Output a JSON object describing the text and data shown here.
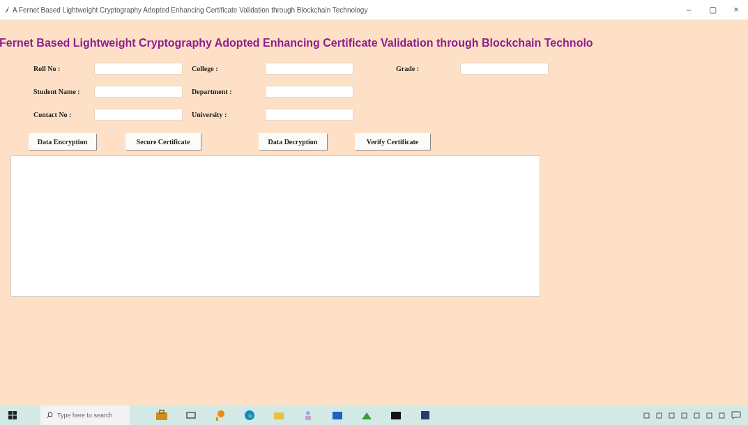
{
  "window": {
    "title": "A Fernet Based Lightweight Cryptography Adopted Enhancing Certificate Validation through Blockchain Technology",
    "controls": [
      "–",
      "▢",
      "×"
    ]
  },
  "heading": "Fernet Based Lightweight Cryptography Adopted Enhancing Certificate Validation through Blockchain Technolo",
  "form": {
    "rows": [
      [
        {
          "label": "Roll No :"
        },
        {
          "label": "College :"
        },
        {
          "label": "Grade :"
        }
      ],
      [
        {
          "label": "Student Name :"
        },
        {
          "label": "Department :"
        }
      ],
      [
        {
          "label": "Contact No :"
        },
        {
          "label": "University :"
        }
      ]
    ]
  },
  "buttons": [
    "Data Encryption",
    "Secure Certificate",
    "Data Decryption",
    "Verify Certificate"
  ],
  "taskbar": {
    "search": {
      "placeholder": "Type here to search"
    }
  }
}
